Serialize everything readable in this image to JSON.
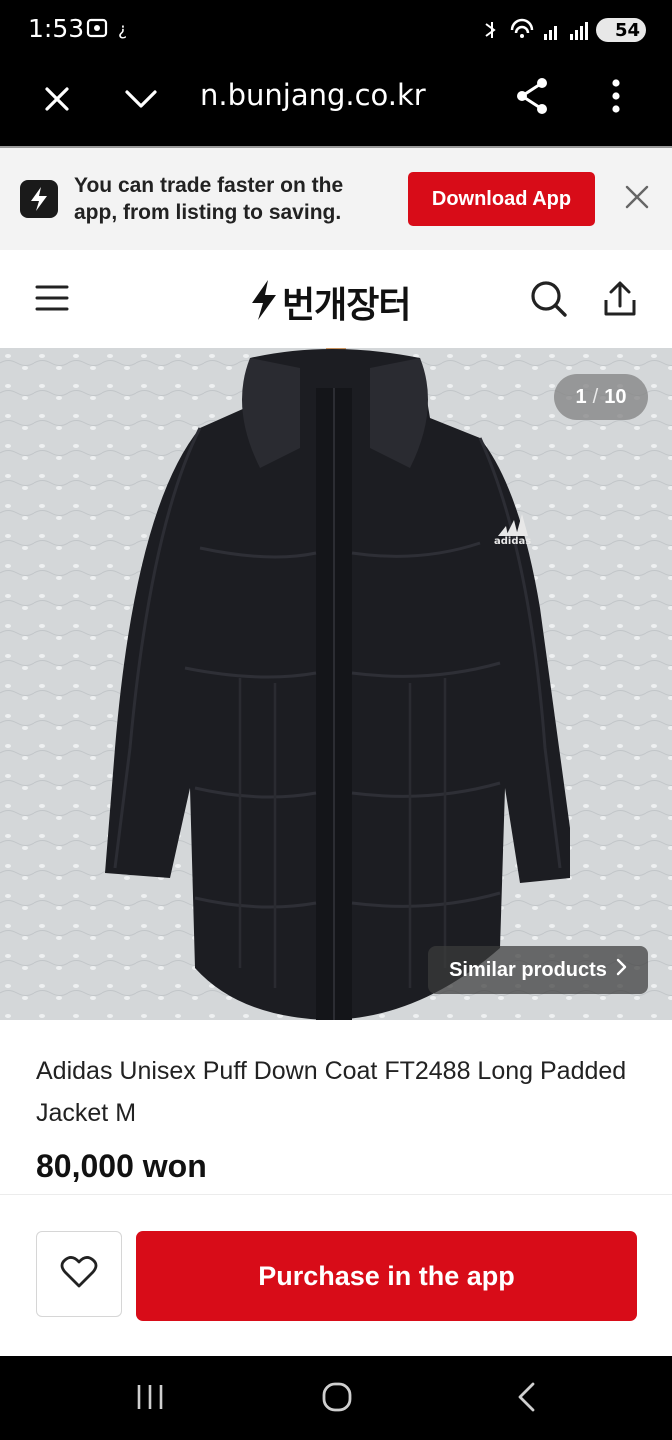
{
  "status_bar": {
    "time": "1:53",
    "battery": "54"
  },
  "browser": {
    "url": "m.bunjang.co.kr",
    "url_visible": "n.bunjang.co.kr"
  },
  "banner": {
    "text": "You can trade faster on the app, from listing to saving.",
    "download_label": "Download App"
  },
  "header": {
    "logo_text": "번개장터"
  },
  "gallery": {
    "current": "1",
    "separator": "/",
    "total": "10",
    "similar_label": "Similar products"
  },
  "product": {
    "title": "Adidas Unisex Puff Down Coat FT2488 Long Padded Jacket M",
    "price": "80,000 won"
  },
  "actions": {
    "purchase_label": "Purchase in the app"
  },
  "colors": {
    "accent": "#d80c18",
    "text": "#222222"
  },
  "icons": [
    "close-icon",
    "chevron-down-icon",
    "share-icon",
    "more-icon",
    "lightning-icon",
    "menu-icon",
    "search-icon",
    "upload-icon",
    "chevron-right-icon",
    "heart-icon",
    "recents-icon",
    "home-icon",
    "back-icon"
  ]
}
